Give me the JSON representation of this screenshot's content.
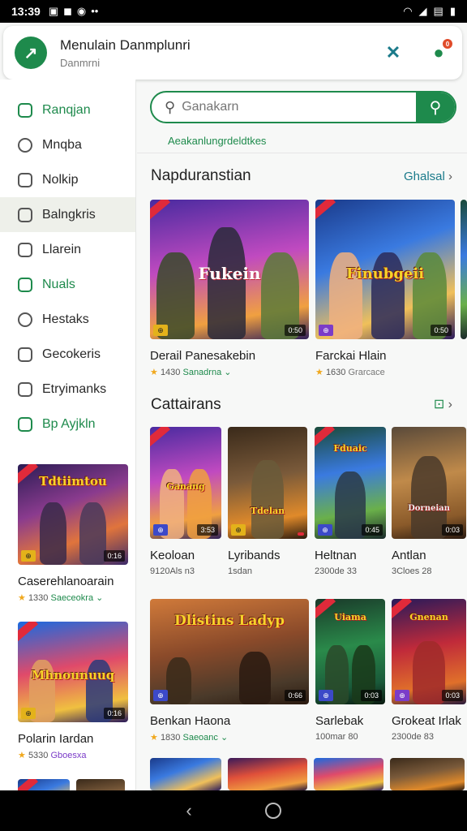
{
  "status_bar": {
    "time": "13:39"
  },
  "header": {
    "logo_glyph": "↗",
    "title": "Menulain Danmplunri",
    "subtitle": "Danmrni"
  },
  "sidebar": {
    "items": [
      {
        "label": "Ranqjan",
        "green": true
      },
      {
        "label": "Mnqba"
      },
      {
        "label": "Nolkip"
      },
      {
        "label": "Balngkris",
        "selected": true
      },
      {
        "label": "Llarein"
      },
      {
        "label": "Nuals",
        "green": true
      },
      {
        "label": "Hestaks"
      },
      {
        "label": "Gecokeris"
      },
      {
        "label": "Etryimanks"
      },
      {
        "label": "Bp Ayjkln",
        "green": true
      }
    ],
    "cards": [
      {
        "title": "Caserehlanoarain",
        "meta": "1330",
        "meta2": "Saeceokra",
        "size": "0:16",
        "banner": "Tdtiimtou"
      },
      {
        "title": "Polarin Iardan",
        "meta": "5330",
        "meta2": "Gboesxa",
        "size": "0:16",
        "banner": "Mhnounuuq"
      }
    ]
  },
  "search": {
    "placeholder": "Ganakarn",
    "hint": "Aeakanlungrdeldtkes"
  },
  "sections": {
    "s1": {
      "title": "Napduranstian",
      "see_all": "Ghalsal",
      "cards": [
        {
          "title": "Derail Panesakebin",
          "rating": "1430",
          "meta": "Sanadrna",
          "size": "0:50",
          "banner": "Fukein"
        },
        {
          "title": "Farckai Hlain",
          "rating": "1630",
          "meta": "Grarcace",
          "size": "0:50",
          "banner": "Finubgeii"
        }
      ]
    },
    "s2": {
      "title": "Cattairans",
      "cards": [
        {
          "title": "Keoloan",
          "meta": "9120Als n3",
          "size": "3:53",
          "banner": "Ganang"
        },
        {
          "title": "Lyribands",
          "meta": "1sdan",
          "size": "",
          "banner": "Tdelan"
        },
        {
          "title": "Heltnan",
          "meta": "2300de 33",
          "size": "0:45",
          "banner": "Fduaic"
        },
        {
          "title": "Antlan",
          "meta": "3Cloes 28",
          "size": "0:03",
          "banner": "Dorneian"
        }
      ]
    },
    "s3": {
      "cards": [
        {
          "title": "Benkan Haona",
          "rating": "1830",
          "meta": "Saeoanc",
          "size": "0:66",
          "banner": "Dlistins Ladyp"
        },
        {
          "title": "Sarlebak",
          "meta": "100mar 80",
          "size": "0:03",
          "banner": "Uiama"
        },
        {
          "title": "Grokeat Irlak",
          "meta": "2300de 83",
          "size": "0:03",
          "banner": "Gnenan"
        }
      ]
    }
  }
}
